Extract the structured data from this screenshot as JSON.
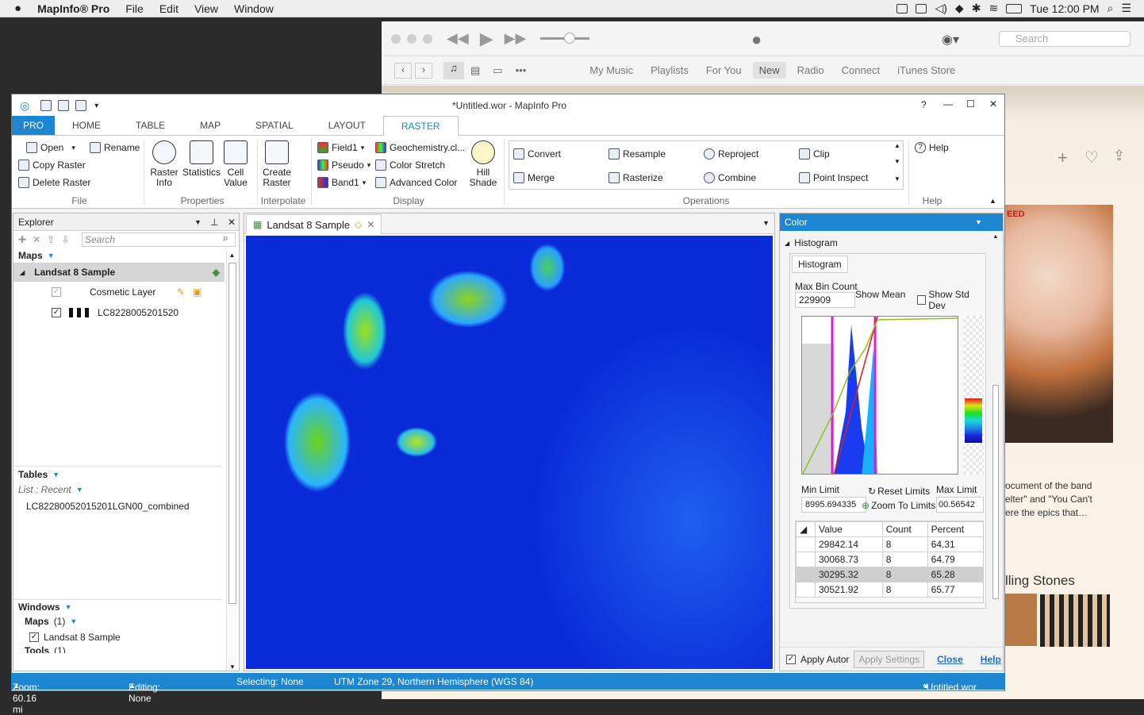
{
  "menubar": {
    "app": "MapInfo® Pro",
    "items": [
      "File",
      "Edit",
      "View",
      "Window"
    ],
    "clock": "Tue 12:00 PM"
  },
  "itunes": {
    "search_placeholder": "Search",
    "tabs": [
      "My Music",
      "Playlists",
      "For You",
      "New",
      "Radio",
      "Connect",
      "iTunes Store"
    ],
    "selected_tab": "New",
    "album_badge": "EED",
    "description": "ocument of the band\nelter\" and \"You Can't\nere the epics that…",
    "artist": "lling Stones"
  },
  "mapinfo": {
    "title": "*Untitled.wor - MapInfo Pro",
    "title_buttons": {
      "help": "?",
      "minimize": "—",
      "maximize": "☐",
      "close": "✕"
    },
    "tabs": [
      "PRO",
      "HOME",
      "TABLE",
      "MAP",
      "SPATIAL",
      "LAYOUT",
      "RASTER"
    ],
    "ribbon": {
      "file": {
        "open": "Open",
        "rename": "Rename",
        "copy": "Copy Raster",
        "delete": "Delete Raster",
        "label": "File"
      },
      "properties": {
        "raster_info": "Raster\nInfo",
        "statistics": "Statistics",
        "cell_value": "Cell\nValue",
        "label": "Properties"
      },
      "interpolate": {
        "create": "Create\nRaster",
        "label": "Interpolate"
      },
      "display": {
        "field1": "Field1",
        "pseudo": "Pseudo",
        "band1": "Band1",
        "geochem": "Geochemistry.cl...",
        "stretch": "Color Stretch",
        "advanced": "Advanced Color",
        "hill": "Hill\nShade",
        "label": "Display"
      },
      "operations": {
        "convert": "Convert",
        "merge": "Merge",
        "resample": "Resample",
        "rasterize": "Rasterize",
        "reproject": "Reproject",
        "combine": "Combine",
        "clip": "Clip",
        "point_inspect": "Point Inspect",
        "label": "Operations"
      },
      "help": {
        "help": "Help",
        "label": "Help"
      }
    },
    "explorer": {
      "title": "Explorer",
      "search_placeholder": "Search",
      "maps_label": "Maps",
      "map_name": "Landsat 8 Sample",
      "layers": [
        "Cosmetic Layer",
        "LC8228005201520"
      ],
      "tables_label": "Tables",
      "list_recent": "List : Recent",
      "table_item": "LC82280052015201LGN00_combined",
      "windows_label": "Windows",
      "windows_maps": "Maps",
      "windows_maps_count": "(1)",
      "window_item": "Landsat 8 Sample",
      "tools_label": "Tools",
      "tools_count": "(1)"
    },
    "mapview": {
      "tab": "Landsat 8 Sample"
    },
    "color": {
      "title": "Color",
      "section": "Histogram",
      "subtab": "Histogram",
      "max_bin_label": "Max Bin Count",
      "max_bin_value": "229909",
      "show_mean": "Show Mean",
      "show_std": "Show Std Dev",
      "min_limit_label": "Min Limit",
      "min_limit_value": "8995.694335",
      "reset_limits": "Reset Limits",
      "zoom_limits": "Zoom To Limits",
      "max_limit_label": "Max Limit",
      "max_limit_value": "00.56542",
      "columns": [
        "Value",
        "Count",
        "Percent"
      ],
      "rows": [
        [
          "29842.14",
          "8",
          "64.31"
        ],
        [
          "30068.73",
          "8",
          "64.79"
        ],
        [
          "30295.32",
          "8",
          "65.28"
        ],
        [
          "30521.92",
          "8",
          "65.77"
        ]
      ],
      "apply_auto": "Apply Autor",
      "apply_settings": "Apply Settings",
      "close": "Close",
      "help": "Help"
    },
    "status": {
      "zoom": "Zoom: 60.16 mi",
      "editing": "Editing: None",
      "selecting": "Selecting: None",
      "projection": "UTM Zone 29, Northern Hemisphere (WGS 84)",
      "workspace": "*Untitled.wor"
    }
  }
}
